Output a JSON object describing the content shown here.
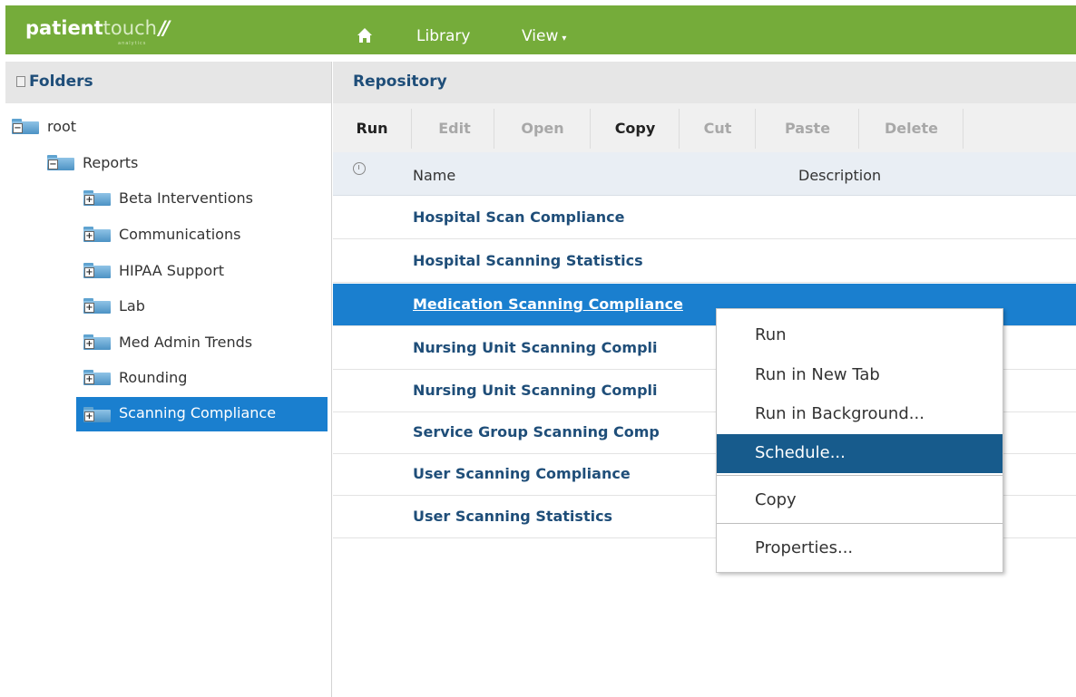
{
  "app": {
    "logo_bold": "patient",
    "logo_light": "touch",
    "logo_slash": "//",
    "logo_sub": "analytics"
  },
  "nav": {
    "library": "Library",
    "view": "View",
    "view_caret": "▾"
  },
  "folders": {
    "title": "Folders",
    "tree": [
      {
        "label": "root",
        "level": 0,
        "expanded": true
      },
      {
        "label": "Reports",
        "level": 1,
        "expanded": true
      },
      {
        "label": "Beta Interventions",
        "level": 2,
        "expanded": false
      },
      {
        "label": "Communications",
        "level": 2,
        "expanded": false
      },
      {
        "label": "HIPAA Support",
        "level": 2,
        "expanded": false
      },
      {
        "label": "Lab",
        "level": 2,
        "expanded": false
      },
      {
        "label": "Med Admin Trends",
        "level": 2,
        "expanded": false
      },
      {
        "label": "Rounding",
        "level": 2,
        "expanded": false
      },
      {
        "label": "Scanning Compliance",
        "level": 2,
        "expanded": false,
        "selected": true
      }
    ]
  },
  "repository": {
    "title": "Repository",
    "toolbar": {
      "run": "Run",
      "edit": "Edit",
      "open": "Open",
      "copy": "Copy",
      "cut": "Cut",
      "paste": "Paste",
      "delete": "Delete"
    },
    "columns": {
      "name": "Name",
      "description": "Description"
    },
    "rows": [
      {
        "name": "Hospital Scan Compliance"
      },
      {
        "name": "Hospital Scanning Statistics"
      },
      {
        "name": "Medication Scanning Compliance",
        "selected": true
      },
      {
        "name": "Nursing Unit Scanning Compli"
      },
      {
        "name": "Nursing Unit Scanning Compli"
      },
      {
        "name": "Service Group Scanning Comp"
      },
      {
        "name": "User Scanning Compliance"
      },
      {
        "name": "User Scanning Statistics"
      }
    ]
  },
  "context_menu": {
    "items": [
      "Run",
      "Run in New Tab",
      "Run in Background...",
      "Schedule...",
      "Copy",
      "Properties..."
    ],
    "highlighted": "Schedule..."
  },
  "colors": {
    "brand_green": "#75ac3a",
    "selection_blue": "#1a7fcf",
    "menu_highlight": "#175b8c",
    "link_blue": "#1f4e79"
  }
}
